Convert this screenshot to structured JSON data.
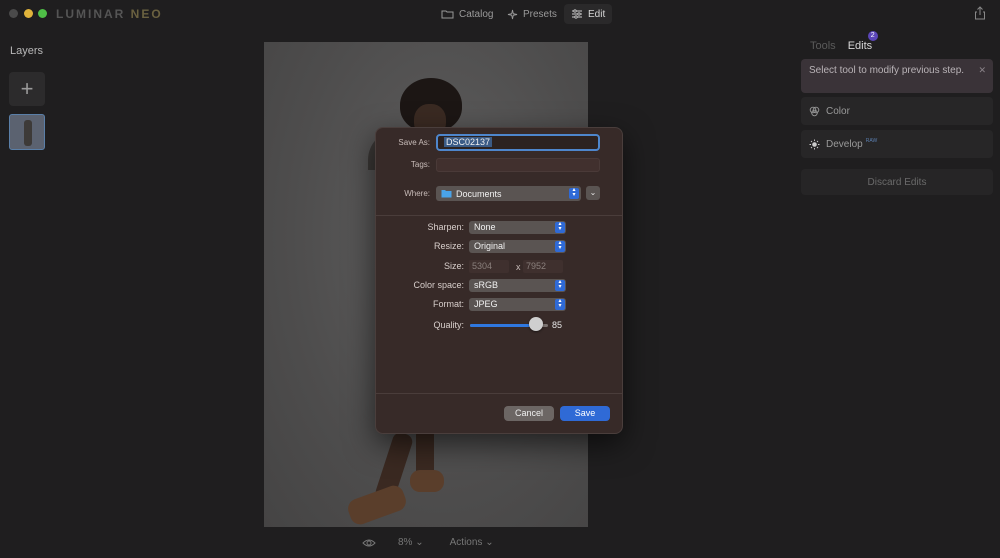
{
  "app": {
    "logo_main": "LUMINAR",
    "logo_accent": "NEO"
  },
  "nav": {
    "catalog": "Catalog",
    "presets": "Presets",
    "edit": "Edit"
  },
  "layers": {
    "title": "Layers",
    "add": "+"
  },
  "right_panel": {
    "tab_tools": "Tools",
    "tab_edits": "Edits",
    "edits_count": "2",
    "hint": "Select tool to modify previous step.",
    "hint_close": "✕",
    "steps": [
      {
        "label": "Color",
        "icon": "color-icon"
      },
      {
        "label": "Develop",
        "tag": "RAW",
        "icon": "sun-icon"
      }
    ],
    "discard": "Discard Edits"
  },
  "bottom": {
    "zoom": "8%",
    "actions": "Actions"
  },
  "export_dialog": {
    "save_as_label": "Save As:",
    "save_as_value": "DSC02137",
    "tags_label": "Tags:",
    "tags_value": "",
    "where_label": "Where:",
    "where_value": "Documents",
    "sharpen_label": "Sharpen:",
    "sharpen_value": "None",
    "resize_label": "Resize:",
    "resize_value": "Original",
    "size_label": "Size:",
    "width": "5304",
    "size_x": "x",
    "height": "7952",
    "color_space_label": "Color space:",
    "color_space_value": "sRGB",
    "format_label": "Format:",
    "format_value": "JPEG",
    "quality_label": "Quality:",
    "quality_value": "85",
    "cancel": "Cancel",
    "save": "Save"
  },
  "colors": {
    "accent": "#2f6ad6",
    "badge": "#5b46b8",
    "dialog_bg": "#372a28"
  }
}
